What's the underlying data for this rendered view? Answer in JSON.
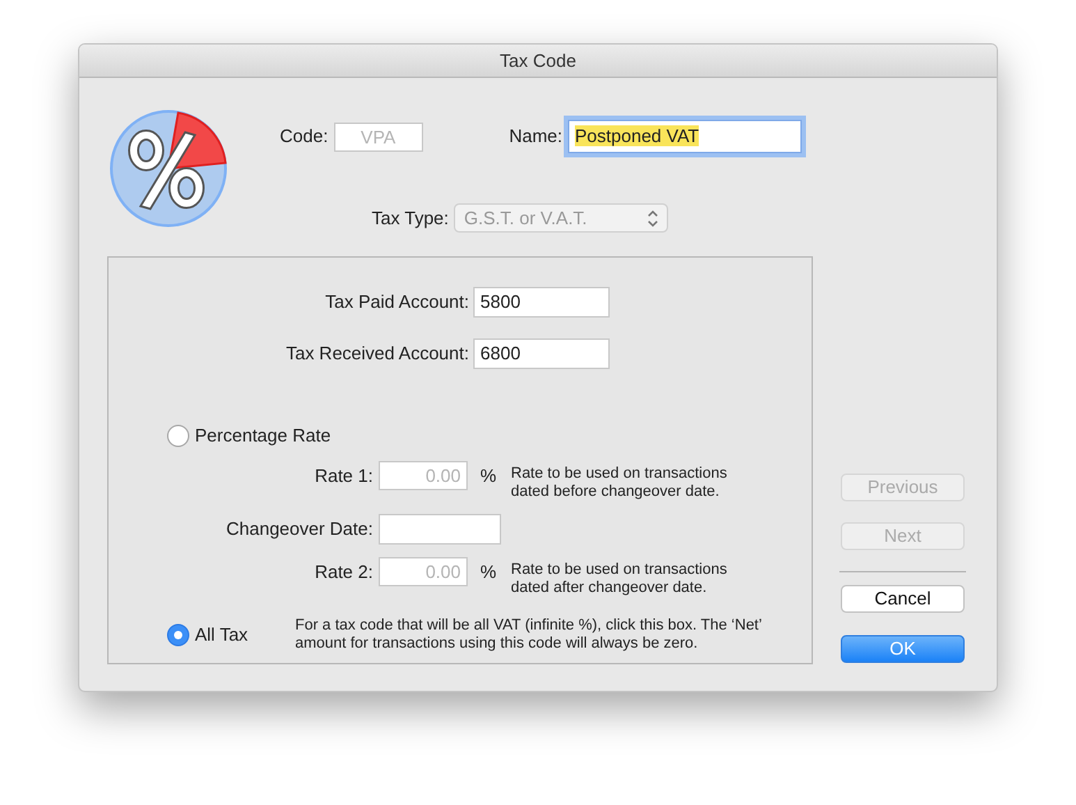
{
  "window": {
    "title": "Tax Code"
  },
  "code": {
    "label": "Code:",
    "value": "VPA",
    "disabled": true
  },
  "name": {
    "label": "Name:",
    "value": "Postponed VAT",
    "highlighted": true,
    "focused": true
  },
  "tax_type": {
    "label": "Tax Type:",
    "value": "G.S.T. or V.A.T.",
    "disabled": true
  },
  "accounts": [
    {
      "label": "Tax Paid Account:",
      "value": "5800"
    },
    {
      "label": "Tax Received Account:",
      "value": "6800"
    }
  ],
  "percentage_rate": {
    "label": "Percentage Rate",
    "selected": false
  },
  "rates": [
    {
      "kind": "rate",
      "label": "Rate 1:",
      "value": "0.00",
      "unit": "%",
      "disabled": true,
      "note": "Rate to be used on transactions dated before changeover date."
    },
    {
      "kind": "date",
      "label": "Changeover Date:"
    },
    {
      "kind": "rate",
      "label": "Rate 2:",
      "value": "0.00",
      "unit": "%",
      "disabled": true,
      "note": "Rate to be used on transactions dated after changeover date."
    }
  ],
  "all_tax": {
    "label": "All Tax",
    "selected": true,
    "note": "For a tax code that will be all VAT (infinite %), click this box. The ‘Net’ amount for transactions using this code will always be zero."
  },
  "buttons": [
    {
      "kind": "nav",
      "label": "Previous",
      "disabled": true
    },
    {
      "kind": "nav",
      "label": "Next",
      "disabled": true
    },
    {
      "kind": "cancel",
      "label": "Cancel",
      "disabled": false
    },
    {
      "kind": "default",
      "label": "OK",
      "disabled": false
    }
  ]
}
